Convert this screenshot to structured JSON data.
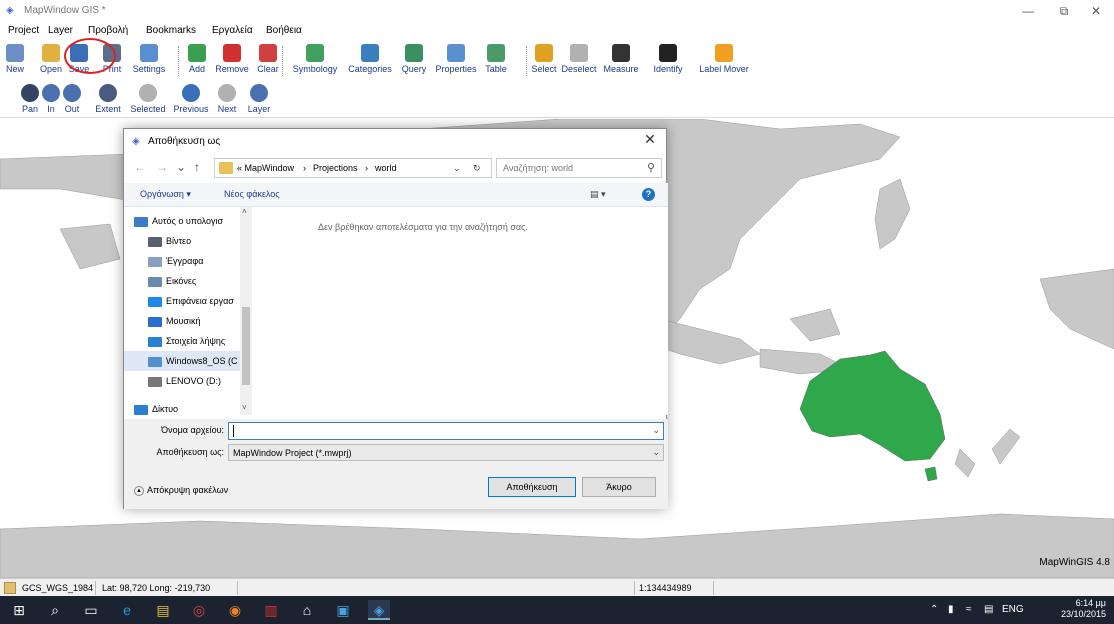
{
  "window": {
    "title": "MapWindow GIS *",
    "minimize": "—",
    "maximize": "⧉",
    "close": "✕"
  },
  "menu": [
    "Project",
    "Layer",
    "Προβολή",
    "Bookmarks",
    "Εργαλεία",
    "Βοήθεια"
  ],
  "toolbar1": [
    {
      "label": "New",
      "icon": "new-icon",
      "color": "#6d8fc8"
    },
    {
      "label": "Open",
      "icon": "open-icon",
      "color": "#e0b040"
    },
    {
      "label": "Save",
      "icon": "save-icon",
      "color": "#3a6fb8"
    },
    {
      "label": "Print",
      "icon": "print-icon",
      "color": "#5d6d8a"
    },
    {
      "label": "Settings",
      "icon": "settings-icon",
      "color": "#5a8fd0"
    },
    {
      "label": "Add",
      "icon": "add-layer-icon",
      "color": "#3aa050"
    },
    {
      "label": "Remove",
      "icon": "remove-layer-icon",
      "color": "#d03030"
    },
    {
      "label": "Clear",
      "icon": "clear-icon",
      "color": "#d04040"
    },
    {
      "label": "Symbology",
      "icon": "symbology-icon",
      "color": "#40a060"
    },
    {
      "label": "Categories",
      "icon": "categories-icon",
      "color": "#3a80c0"
    },
    {
      "label": "Query",
      "icon": "query-icon",
      "color": "#3a9060"
    },
    {
      "label": "Properties",
      "icon": "properties-icon",
      "color": "#5a8fd0"
    },
    {
      "label": "Table",
      "icon": "table-icon",
      "color": "#4a9a6a"
    },
    {
      "label": "Select",
      "icon": "select-icon",
      "color": "#e0a020"
    },
    {
      "label": "Deselect",
      "icon": "deselect-icon",
      "color": "#b0b0b0"
    },
    {
      "label": "Measure",
      "icon": "measure-icon",
      "color": "#333333"
    },
    {
      "label": "Identify",
      "icon": "identify-icon",
      "color": "#222222"
    },
    {
      "label": "Label Mover",
      "icon": "label-mover-icon",
      "color": "#f0a020"
    }
  ],
  "toolbar2": [
    {
      "label": "Pan",
      "icon": "pan-icon",
      "color": "#334466"
    },
    {
      "label": "In",
      "icon": "zoom-in-icon",
      "color": "#4a70b0"
    },
    {
      "label": "Out",
      "icon": "zoom-out-icon",
      "color": "#4a70b0"
    },
    {
      "label": "Extent",
      "icon": "extent-icon",
      "color": "#4a5a80"
    },
    {
      "label": "Selected",
      "icon": "zoom-selected-icon",
      "color": "#b0b0b0"
    },
    {
      "label": "Previous",
      "icon": "previous-icon",
      "color": "#3a70b8"
    },
    {
      "label": "Next",
      "icon": "next-icon",
      "color": "#b0b0b0"
    },
    {
      "label": "Layer",
      "icon": "zoom-layer-icon",
      "color": "#4a70b0"
    }
  ],
  "map": {
    "label": "MapWinGIS 4.8",
    "land_color": "#c8c8c8",
    "highlight_color": "#2ea84a"
  },
  "status": {
    "projection": "GCS_WGS_1984",
    "coords": "Lat: 98,720 Long: -219,730",
    "scale": "1:134434989"
  },
  "dialog": {
    "title": "Αποθήκευση ως",
    "breadcrumb": [
      "« MapWindow",
      "›",
      "Projections",
      "›",
      "world"
    ],
    "search_placeholder": "Αναζήτηση: world",
    "organize": "Οργάνωση ▾",
    "new_folder": "Νέος φάκελος",
    "empty_message": "Δεν βρέθηκαν αποτελέσματα για την αναζήτησή σας.",
    "tree": [
      {
        "label": "Αυτός ο υπολογισ",
        "icon": "computer-icon",
        "color": "#3a7cc8",
        "indent": 0
      },
      {
        "label": "Βίντεο",
        "icon": "video-icon",
        "color": "#556070",
        "indent": 1
      },
      {
        "label": "Έγγραφα",
        "icon": "documents-icon",
        "color": "#8aa0c0",
        "indent": 1
      },
      {
        "label": "Εικόνες",
        "icon": "pictures-icon",
        "color": "#6a8ab0",
        "indent": 1
      },
      {
        "label": "Επιφάνεια εργασ",
        "icon": "desktop-icon",
        "color": "#1e88e5",
        "indent": 1
      },
      {
        "label": "Μουσική",
        "icon": "music-icon",
        "color": "#2a6fd0",
        "indent": 1
      },
      {
        "label": "Στοιχεία λήψης",
        "icon": "downloads-icon",
        "color": "#2a7fd0",
        "indent": 1
      },
      {
        "label": "Windows8_OS (C",
        "icon": "drive-c-icon",
        "color": "#5090d0",
        "indent": 1,
        "selected": true
      },
      {
        "label": "LENOVO (D:)",
        "icon": "drive-d-icon",
        "color": "#777777",
        "indent": 1
      },
      {
        "label": "Δίκτυο",
        "icon": "network-icon",
        "color": "#2a7fd0",
        "indent": 0
      }
    ],
    "filename_label": "Όνομα αρχείου:",
    "filename_value": "",
    "filetype_label": "Αποθήκευση ως:",
    "filetype_value": "MapWindow Project (*.mwprj)",
    "hide_folders": "Απόκρυψη φακέλων",
    "save_button": "Αποθήκευση",
    "cancel_button": "Άκυρο"
  },
  "taskbar": {
    "apps": [
      {
        "icon": "windows-start-icon",
        "glyph": "⊞"
      },
      {
        "icon": "search-icon",
        "glyph": "⌕"
      },
      {
        "icon": "task-view-icon",
        "glyph": "▭"
      },
      {
        "icon": "edge-icon",
        "glyph": "e"
      },
      {
        "icon": "file-explorer-icon",
        "glyph": "▤"
      },
      {
        "icon": "chrome-icon",
        "glyph": "◎"
      },
      {
        "icon": "firefox-icon",
        "glyph": "◉"
      },
      {
        "icon": "popcorn-icon",
        "glyph": "▥"
      },
      {
        "icon": "home-icon",
        "glyph": "⌂"
      },
      {
        "icon": "store-icon",
        "glyph": "▣"
      },
      {
        "icon": "mapwindow-icon",
        "glyph": "◈"
      }
    ],
    "tray_lang": "ENG",
    "time": "6:14 μμ",
    "date": "23/10/2015"
  }
}
